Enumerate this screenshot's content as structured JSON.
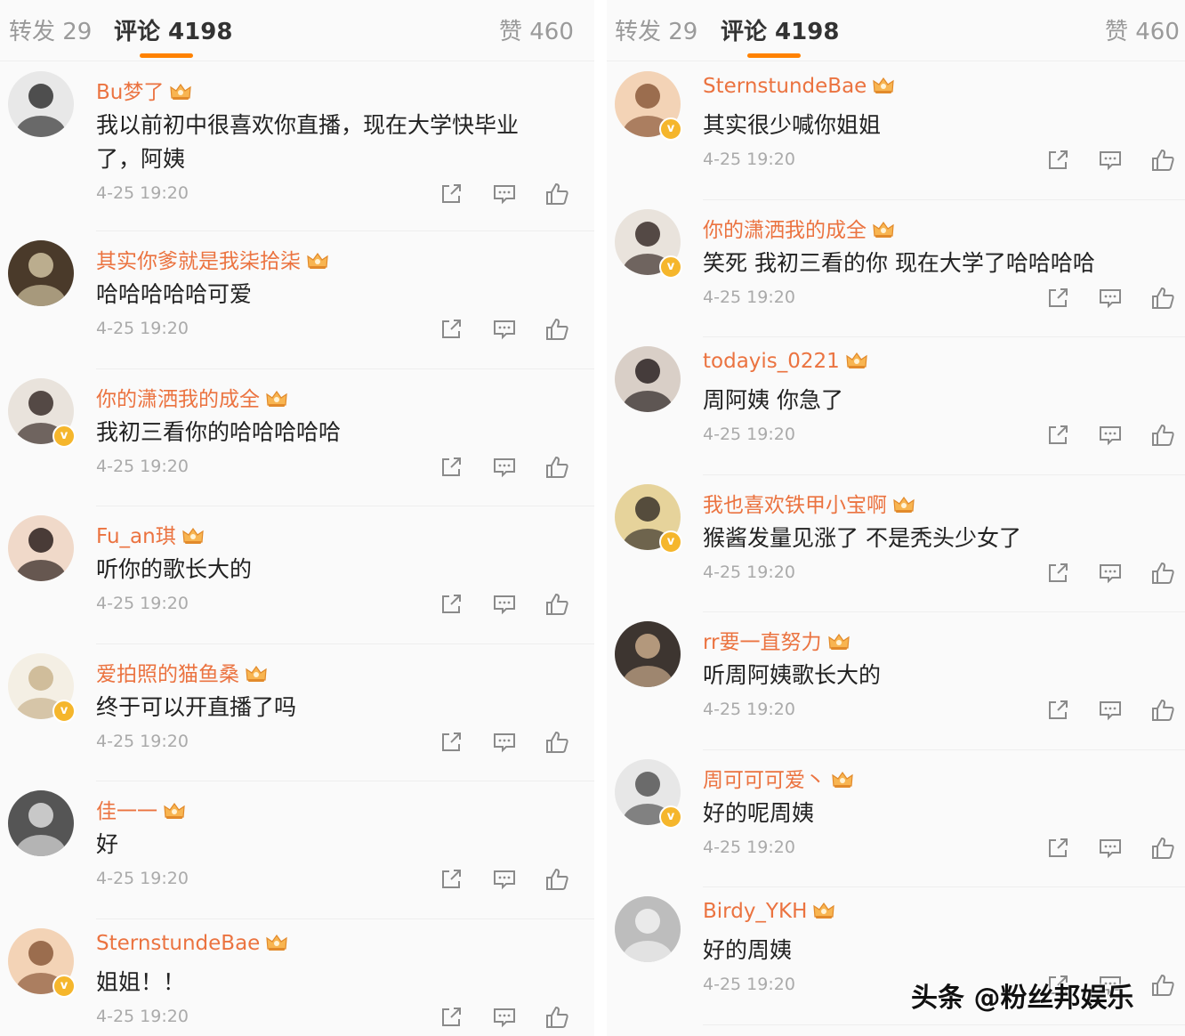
{
  "left": {
    "tabs": {
      "repost": "转发 29",
      "comments": "评论 4198",
      "likes": "赞 460"
    },
    "comments": [
      {
        "user": "Bu梦了",
        "text": "我以前初中很喜欢你直播，现在大学快毕业了，阿姨",
        "time": "4-25 19:20",
        "verified": false,
        "avatar_colors": [
          "#e8e8e8",
          "#333"
        ]
      },
      {
        "user": "其实你爹就是我柒拾柒",
        "text": "哈哈哈哈哈可爱",
        "time": "4-25 19:20",
        "verified": false,
        "avatar_colors": [
          "#4a3a2a",
          "#cfc2a0"
        ]
      },
      {
        "user": "你的潇洒我的成全",
        "text": "我初三看你的哈哈哈哈哈",
        "time": "4-25 19:20",
        "verified": true,
        "avatar_colors": [
          "#e9e3dc",
          "#3a2e2a"
        ]
      },
      {
        "user": "Fu_an琪",
        "text": "听你的歌长大的",
        "time": "4-25 19:20",
        "verified": false,
        "avatar_colors": [
          "#f0d9c9",
          "#2b1f1d"
        ]
      },
      {
        "user": "爱拍照的猫鱼桑",
        "text": "终于可以开直播了吗",
        "time": "4-25 19:20",
        "verified": true,
        "avatar_colors": [
          "#f4efe4",
          "#c9b48e"
        ]
      },
      {
        "user": "佳一一",
        "text": "好",
        "time": "4-25 19:20",
        "verified": false,
        "avatar_colors": [
          "#555",
          "#ddd"
        ]
      },
      {
        "user": "SternstundeBae",
        "text": "姐姐！！",
        "time": "4-25 19:20",
        "verified": true,
        "avatar_colors": [
          "#f3d3b6",
          "#8b5a3c"
        ]
      }
    ]
  },
  "right": {
    "tabs": {
      "repost": "转发 29",
      "comments": "评论 4198",
      "likes": "赞 460"
    },
    "comments": [
      {
        "user": "SternstundeBae",
        "text": "其实很少喊你姐姐",
        "time": "4-25 19:20",
        "verified": true,
        "avatar_colors": [
          "#f3d3b6",
          "#8b5a3c"
        ]
      },
      {
        "user": "你的潇洒我的成全",
        "text": "笑死 我初三看的你 现在大学了哈哈哈哈",
        "time": "4-25 19:20",
        "verified": true,
        "avatar_colors": [
          "#e9e3dc",
          "#3a2e2a"
        ]
      },
      {
        "user": "todayis_0221",
        "text": "周阿姨 你急了",
        "time": "4-25 19:20",
        "verified": false,
        "avatar_colors": [
          "#d9cfc7",
          "#2a2222"
        ]
      },
      {
        "user": "我也喜欢铁甲小宝啊",
        "text": "猴酱发量见涨了  不是秃头少女了",
        "time": "4-25 19:20",
        "verified": true,
        "avatar_colors": [
          "#e6d39b",
          "#3b342c"
        ]
      },
      {
        "user": "rr要一直努力",
        "text": "听周阿姨歌长大的",
        "time": "4-25 19:20",
        "verified": false,
        "avatar_colors": [
          "#3d3530",
          "#c8a98a"
        ]
      },
      {
        "user": "周可可可爱丶",
        "text": "好的呢周姨",
        "time": "4-25 19:20",
        "verified": true,
        "avatar_colors": [
          "#e7e7e7",
          "#555"
        ]
      },
      {
        "user": "Birdy_YKH",
        "text": "好的周姨",
        "time": "4-25 19:20",
        "verified": false,
        "avatar_colors": [
          "#bdbdbd",
          "#f2f2f2"
        ]
      }
    ]
  },
  "verified_mark": "v",
  "icons": {
    "share": "share-icon",
    "comment": "comment-icon",
    "like": "like-icon",
    "crown": "crown-badge-icon"
  },
  "colors": {
    "accent": "#ff8200",
    "username": "#eb7340",
    "badge": "#f5b62c"
  },
  "watermark": "头条 @粉丝邦娱乐"
}
